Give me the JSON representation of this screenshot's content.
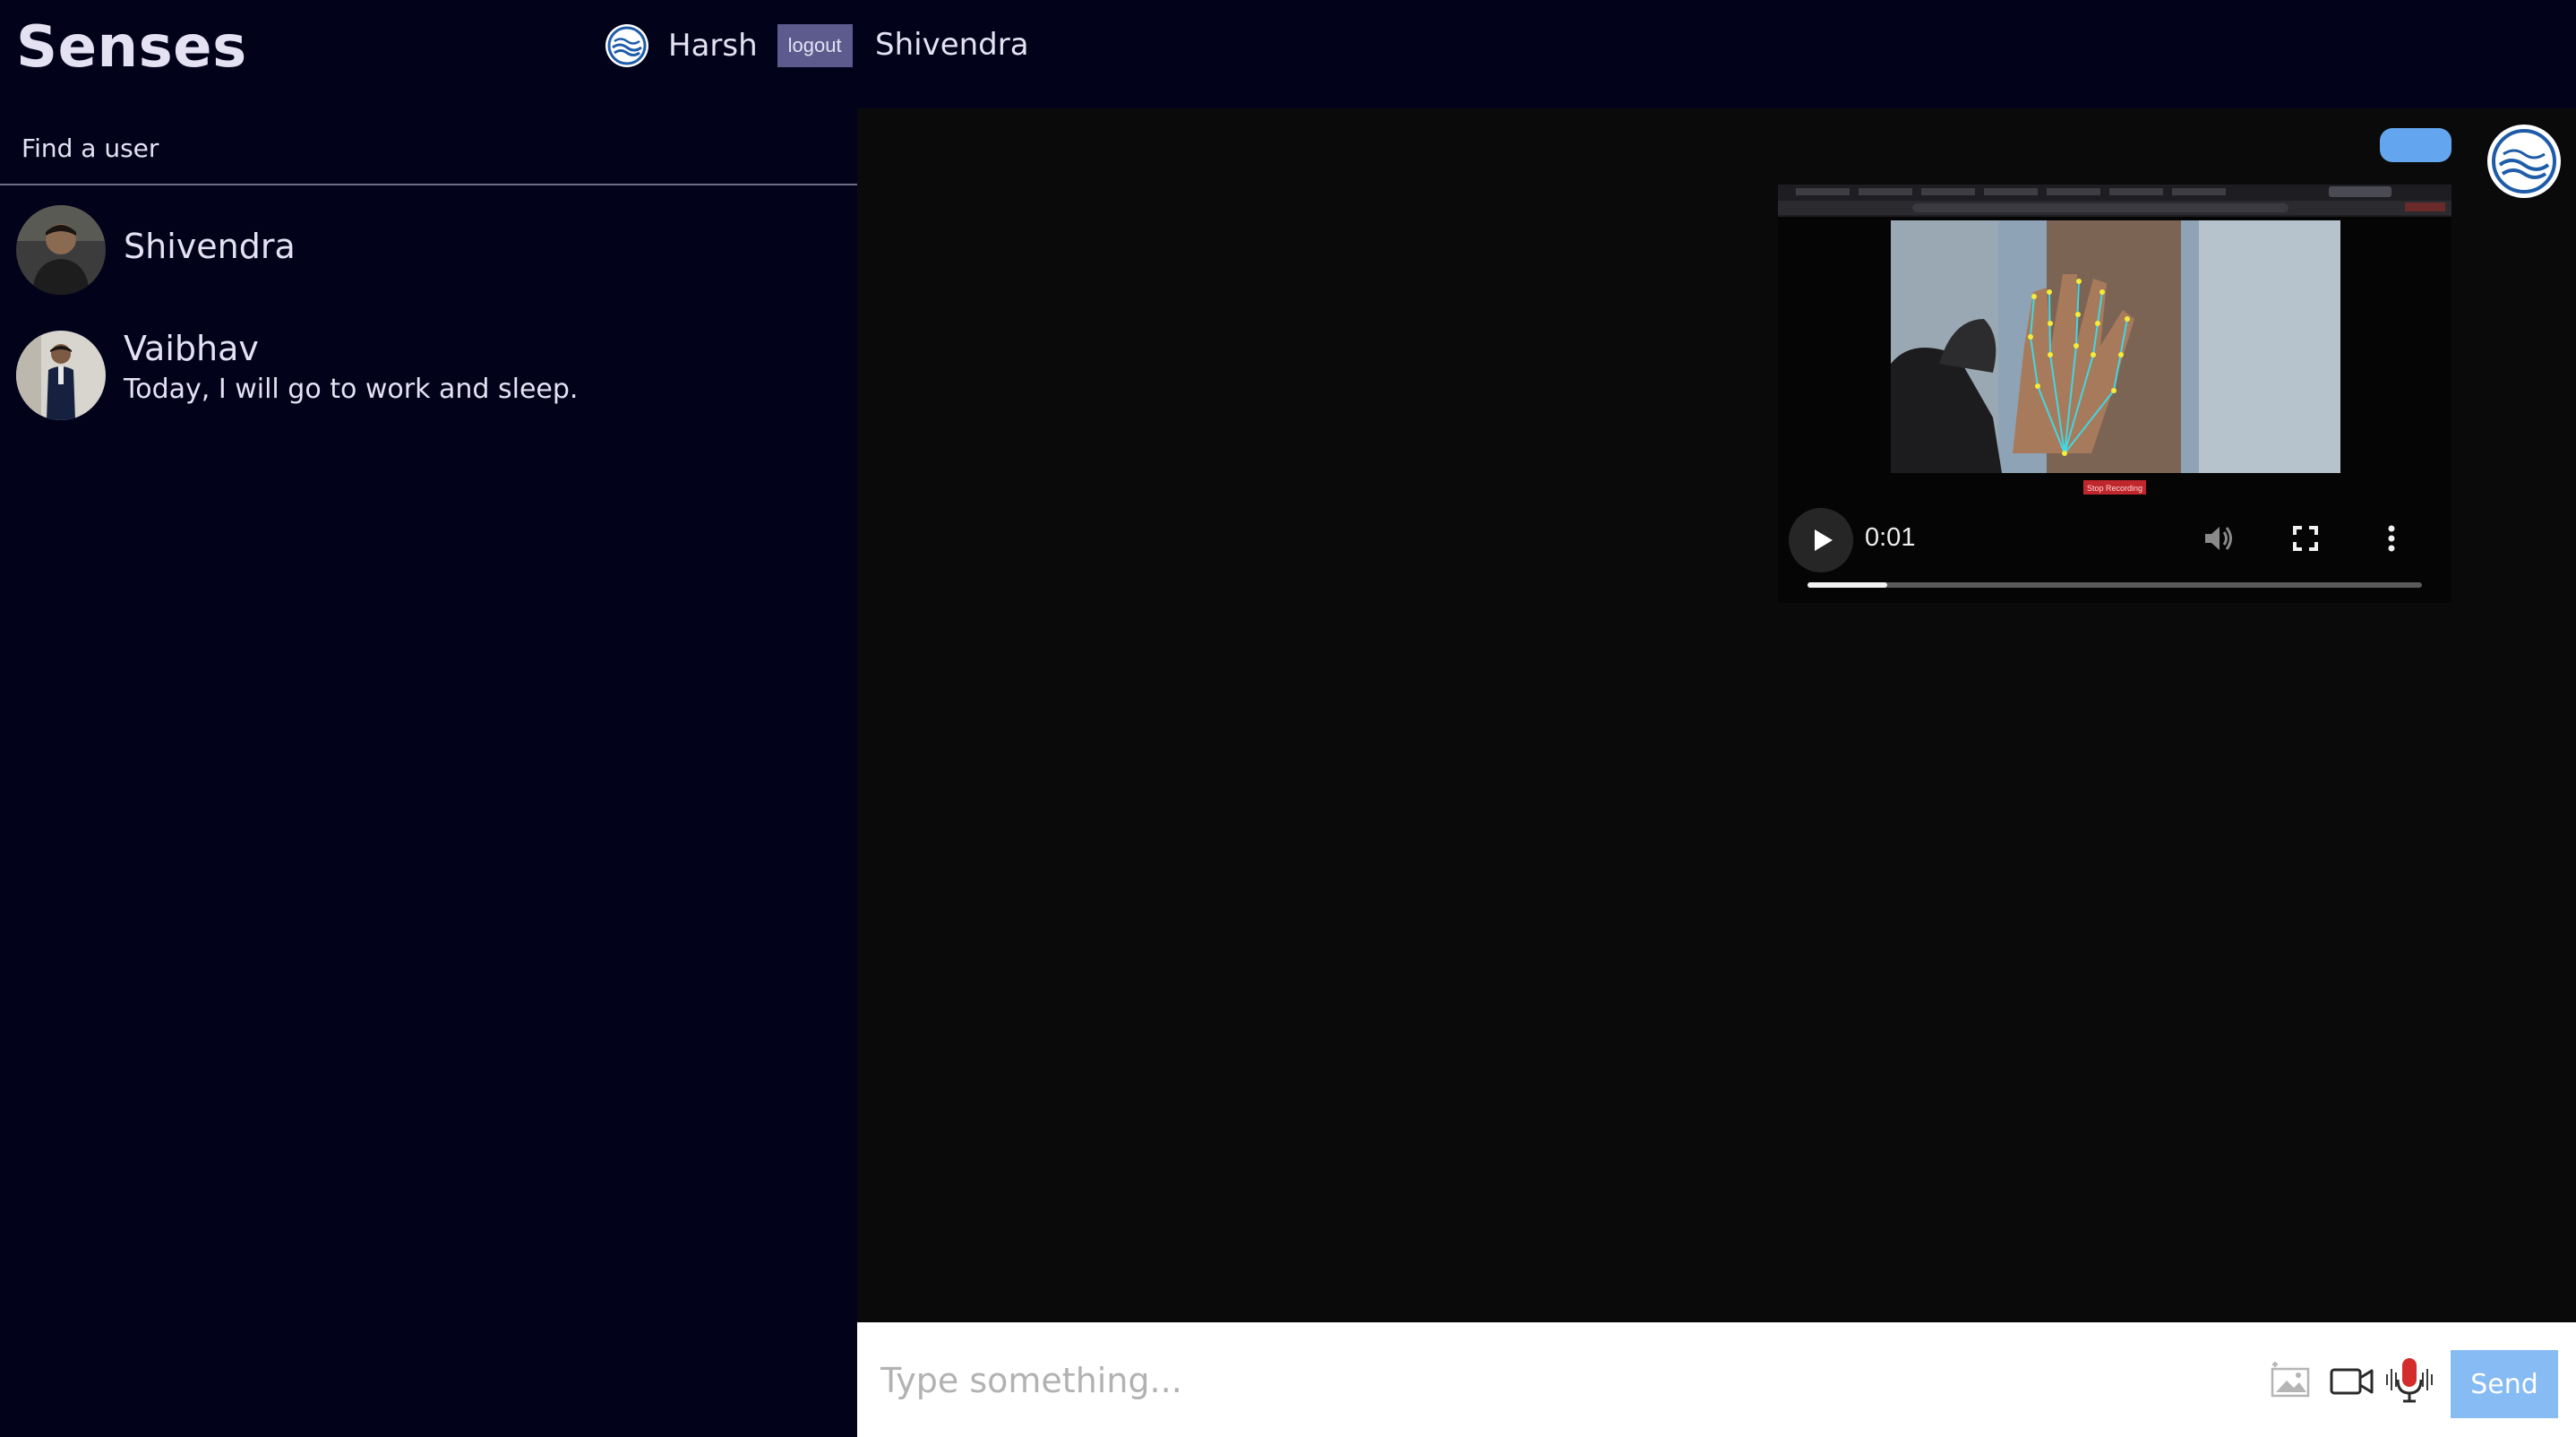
{
  "app": {
    "brand": "Senses",
    "current_user": "Harsh",
    "logout_label": "logout",
    "active_chat_name": "Shivendra"
  },
  "sidebar": {
    "search_placeholder": "Find a user",
    "users": [
      {
        "name": "Shivendra",
        "last_message": ""
      },
      {
        "name": "Vaibhav",
        "last_message": "Today, I will go to work and sleep."
      }
    ]
  },
  "video": {
    "time": "0:01",
    "progress": 0.13,
    "overlay_text": "Stop Recording"
  },
  "composer": {
    "placeholder": "Type something...",
    "send_label": "Send"
  },
  "colors": {
    "sidebar_bg": "#03021b",
    "chat_bg": "#0a0a0a",
    "logout_bg": "#5d5b8d",
    "send_bg": "#86bbf3",
    "bubble": "#64a5f0"
  },
  "icons": [
    "philips-logo-icon",
    "play-icon",
    "volume-icon",
    "fullscreen-icon",
    "more-vert-icon",
    "image-icon",
    "video-camera-icon",
    "microphone-icon"
  ]
}
